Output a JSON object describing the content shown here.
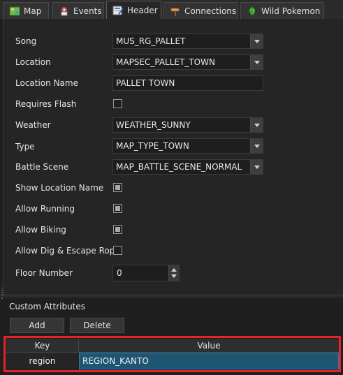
{
  "tabs": [
    {
      "label": "Map",
      "icon": "map-icon"
    },
    {
      "label": "Events",
      "icon": "events-icon"
    },
    {
      "label": "Header",
      "icon": "header-icon",
      "active": true
    },
    {
      "label": "Connections",
      "icon": "connections-icon"
    },
    {
      "label": "Wild Pokemon",
      "icon": "wild-pokemon-icon"
    }
  ],
  "header": {
    "song": {
      "label": "Song",
      "value": "MUS_RG_PALLET"
    },
    "location": {
      "label": "Location",
      "value": "MAPSEC_PALLET_TOWN"
    },
    "location_name": {
      "label": "Location Name",
      "value": "PALLET TOWN"
    },
    "requires_flash": {
      "label": "Requires Flash",
      "checked": false
    },
    "weather": {
      "label": "Weather",
      "value": "WEATHER_SUNNY"
    },
    "type": {
      "label": "Type",
      "value": "MAP_TYPE_TOWN"
    },
    "battle_scene": {
      "label": "Battle Scene",
      "value": "MAP_BATTLE_SCENE_NORMAL"
    },
    "show_location_name": {
      "label": "Show Location Name",
      "checked": true
    },
    "allow_running": {
      "label": "Allow Running",
      "checked": true
    },
    "allow_biking": {
      "label": "Allow Biking",
      "checked": true
    },
    "allow_dig": {
      "label": "Allow Dig & Escape Rope",
      "checked": false
    },
    "floor_number": {
      "label": "Floor Number",
      "value": "0"
    }
  },
  "custom_attributes": {
    "title": "Custom Attributes",
    "add_label": "Add",
    "delete_label": "Delete",
    "columns": {
      "key": "Key",
      "value": "Value"
    },
    "rows": [
      {
        "key": "region",
        "value": "REGION_KANTO"
      }
    ]
  },
  "colors": {
    "highlight_border": "#e0262c",
    "selected_cell": "#1d5573"
  }
}
